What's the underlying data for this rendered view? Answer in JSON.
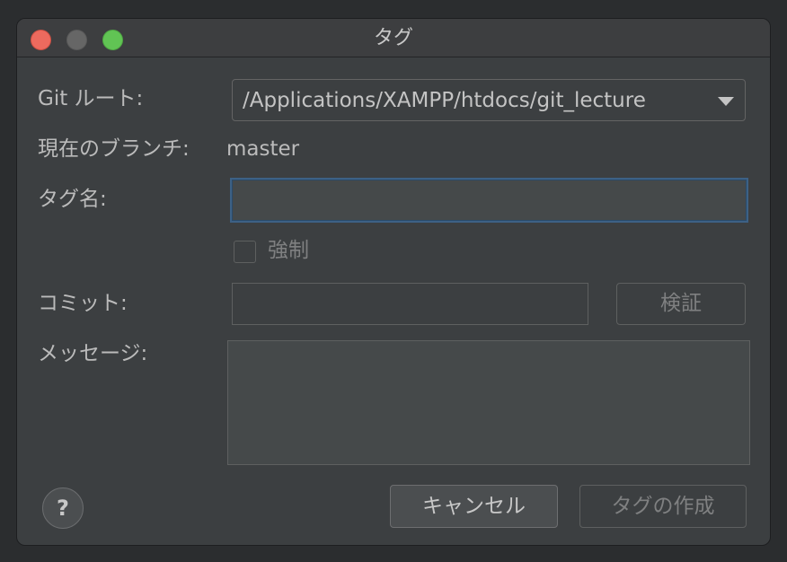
{
  "window": {
    "title": "タグ"
  },
  "form": {
    "git_root_label": "Git ルート:",
    "git_root_value": "/Applications/XAMPP/htdocs/git_lecture",
    "current_branch_label": "現在のブランチ:",
    "current_branch_value": "master",
    "tag_name_label": "タグ名:",
    "tag_name_value": "",
    "force_label": "強制",
    "force_checked": false,
    "commit_label": "コミット:",
    "commit_value": "",
    "verify_label": "検証",
    "message_label": "メッセージ:",
    "message_value": ""
  },
  "buttons": {
    "help_label": "?",
    "cancel_label": "キャンセル",
    "create_label": "タグの作成"
  },
  "icons": {
    "close": "close-icon",
    "minimize": "minimize-icon",
    "maximize": "maximize-icon",
    "dropdown": "chevron-down-icon",
    "help": "help-icon"
  },
  "colors": {
    "close": "#ed6a5e",
    "minimize": "#666666",
    "maximize": "#61c454",
    "focus_border": "#3d6185",
    "background": "#3c3f41"
  }
}
